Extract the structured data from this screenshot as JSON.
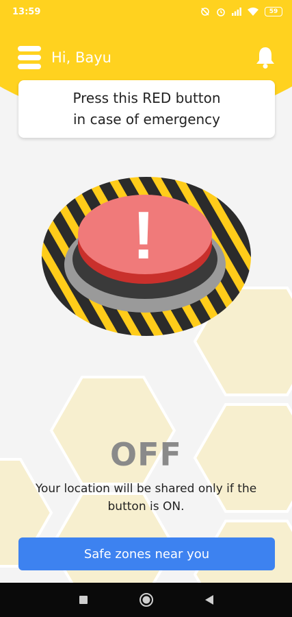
{
  "status_bar": {
    "time": "13:59",
    "battery": "59",
    "icons": [
      "alarm-off-icon",
      "alarm-icon",
      "signal-icon",
      "wifi-icon",
      "battery-icon"
    ]
  },
  "header": {
    "greeting": "Hi, Bayu",
    "menu_icon": "hamburger-menu-icon",
    "notification_icon": "bell-icon"
  },
  "instruction": {
    "line1": "Press this RED button",
    "line2": "in case of emergency"
  },
  "panic_button": {
    "symbol": "!",
    "state": "OFF"
  },
  "location_note": "Your location will be shared only if the button is ON.",
  "safe_zones_button": "Safe zones near you",
  "nav_bar": {
    "icons": [
      "recent-apps-icon",
      "home-icon",
      "back-icon"
    ]
  },
  "colors": {
    "accent_yellow": "#ffd21f",
    "button_red": "#f07a7a",
    "primary_blue": "#3d82f0",
    "state_gray": "#8a8a8a"
  }
}
